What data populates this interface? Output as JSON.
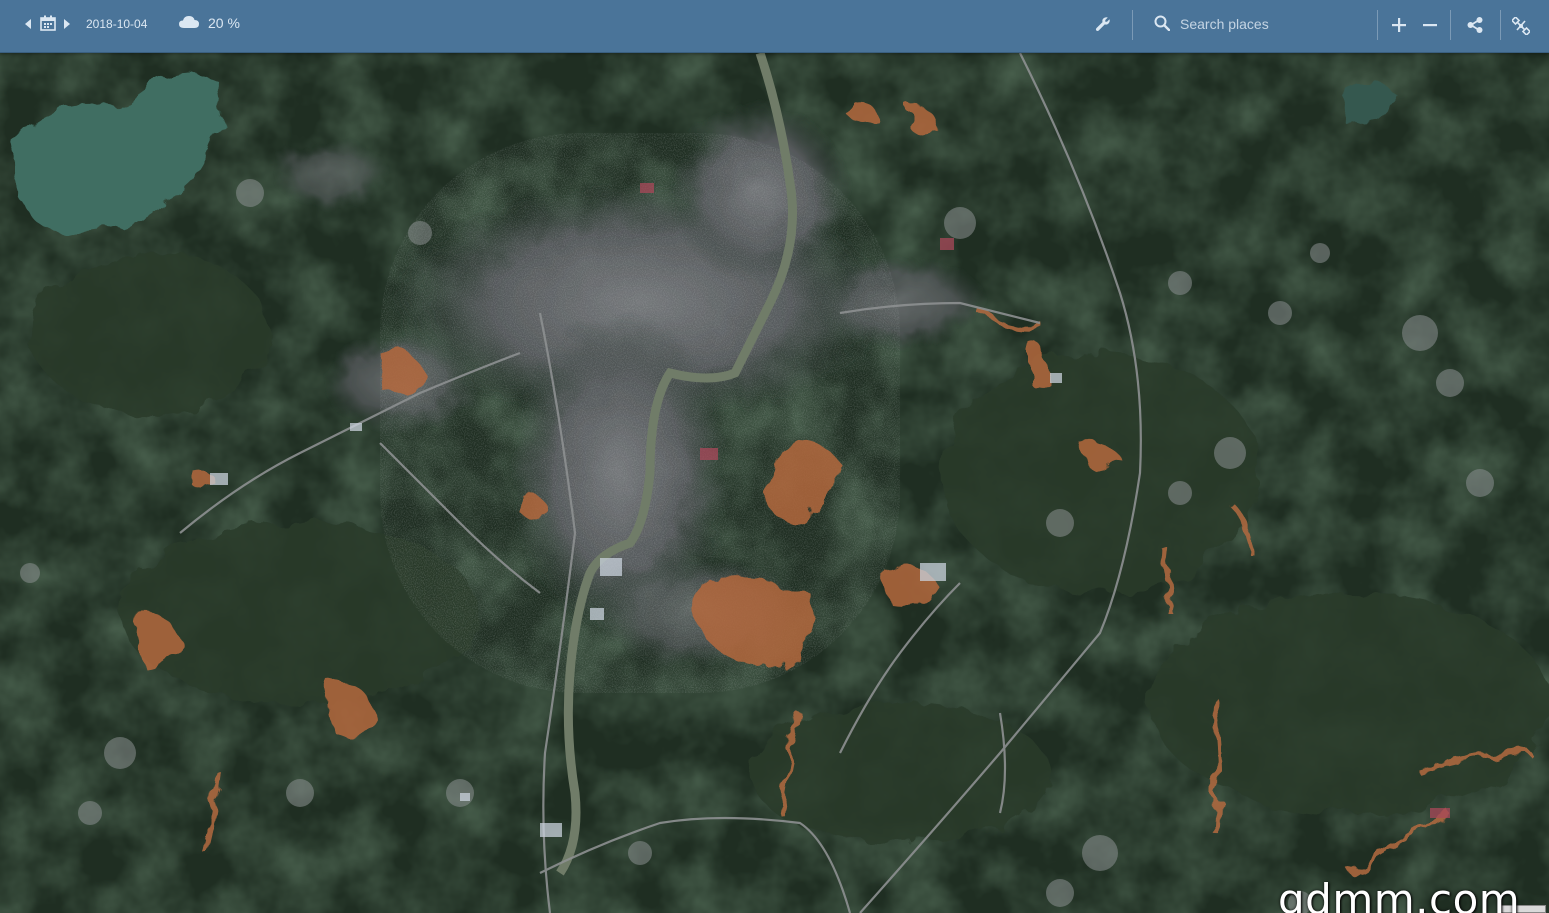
{
  "toolbar": {
    "date": "2018-10-04",
    "cloud_coverage": "20 %",
    "search": {
      "placeholder": "Search places",
      "value": ""
    },
    "zoom_in_label": "+",
    "zoom_out_label": "−"
  },
  "map": {
    "watermark": "gdmm.com",
    "colors": {
      "forest": "#1f2e22",
      "urban": "#5c5f63",
      "bare_soil": "#b3673e",
      "water": "#3f6e62",
      "river": "#707c68",
      "road": "#8d9091"
    }
  },
  "theme": {
    "toolbar_bg": "#4a7499",
    "toolbar_text": "#dbe7f2"
  }
}
